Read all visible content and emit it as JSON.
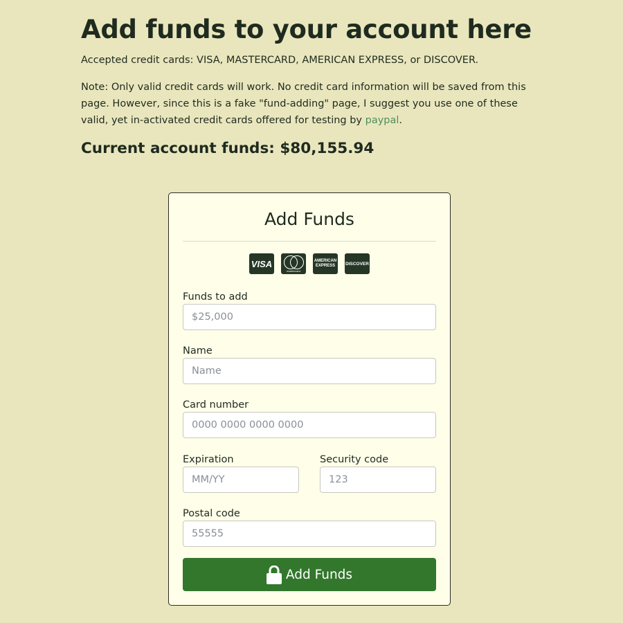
{
  "header": {
    "title": "Add funds to your account here",
    "accepted": "Accepted credit cards: VISA, MASTERCARD, AMERICAN EXPRESS, or DISCOVER.",
    "note_text": "Note: Only valid credit cards will work. No credit card information will be saved from this page. However, since this is a fake \"fund-adding\" page, I suggest you use one of these valid, yet in-activated credit cards offered for testing by ",
    "note_link": "paypal",
    "note_end": ".",
    "funds": "Current account funds: $80,155.94"
  },
  "card": {
    "title": "Add Funds",
    "icons": {
      "visa": "VISA",
      "mastercard": "mastercard",
      "amex": "AMERICAN EXPRESS",
      "discover": "DISCOVER"
    },
    "fields": {
      "funds": {
        "label": "Funds to add",
        "placeholder": "$25,000"
      },
      "name": {
        "label": "Name",
        "placeholder": "Name"
      },
      "card_number": {
        "label": "Card number",
        "placeholder": "0000 0000 0000 0000"
      },
      "expiration": {
        "label": "Expiration",
        "placeholder": "MM/YY"
      },
      "security": {
        "label": "Security code",
        "placeholder": "123"
      },
      "postal": {
        "label": "Postal code",
        "placeholder": "55555"
      }
    },
    "button": "Add Funds",
    "button_icon": "lock-icon"
  },
  "colors": {
    "background": "#e9e6bd",
    "card_background": "#fefee9",
    "button": "#32772c",
    "link": "#4e8f5e"
  }
}
